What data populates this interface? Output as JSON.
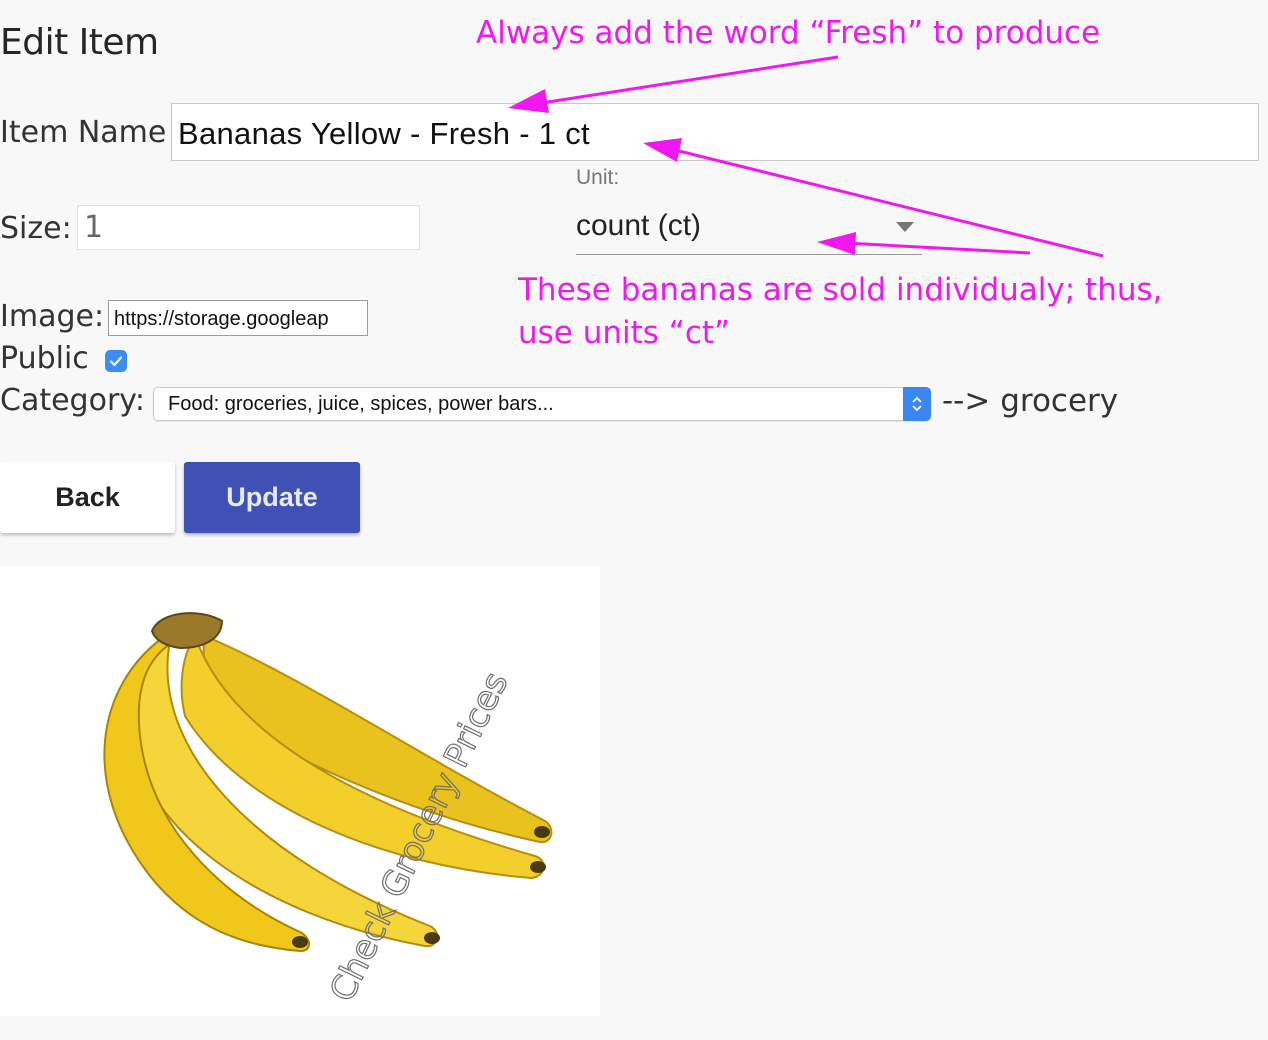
{
  "page": {
    "title": "Edit Item"
  },
  "form": {
    "item_name_label": "Item Name",
    "item_name_value": "Bananas Yellow - Fresh - 1 ct",
    "size_label": "Size:",
    "size_value": "1",
    "unit_label": "Unit:",
    "unit_value": "count (ct)",
    "image_label": "Image:",
    "image_value": "https://storage.googleap",
    "public_label": "Public",
    "public_checked": true,
    "category_label": "Category:",
    "category_value": "Food: groceries, juice, spices, power bars...",
    "category_note": "--> grocery"
  },
  "buttons": {
    "back": "Back",
    "update": "Update"
  },
  "image": {
    "watermark": "Check Grocery Prices",
    "subject": "bunch of yellow bananas"
  },
  "annotations": {
    "color": "#f018f0",
    "fresh_note": "Always add the word “Fresh” to produce",
    "units_note_line1": "These bananas are sold individualy; thus,",
    "units_note_line2": "use units “ct”"
  },
  "colors": {
    "update_button": "#3f51b5",
    "checkbox": "#3d8bf5",
    "background": "#f8f8f8"
  }
}
